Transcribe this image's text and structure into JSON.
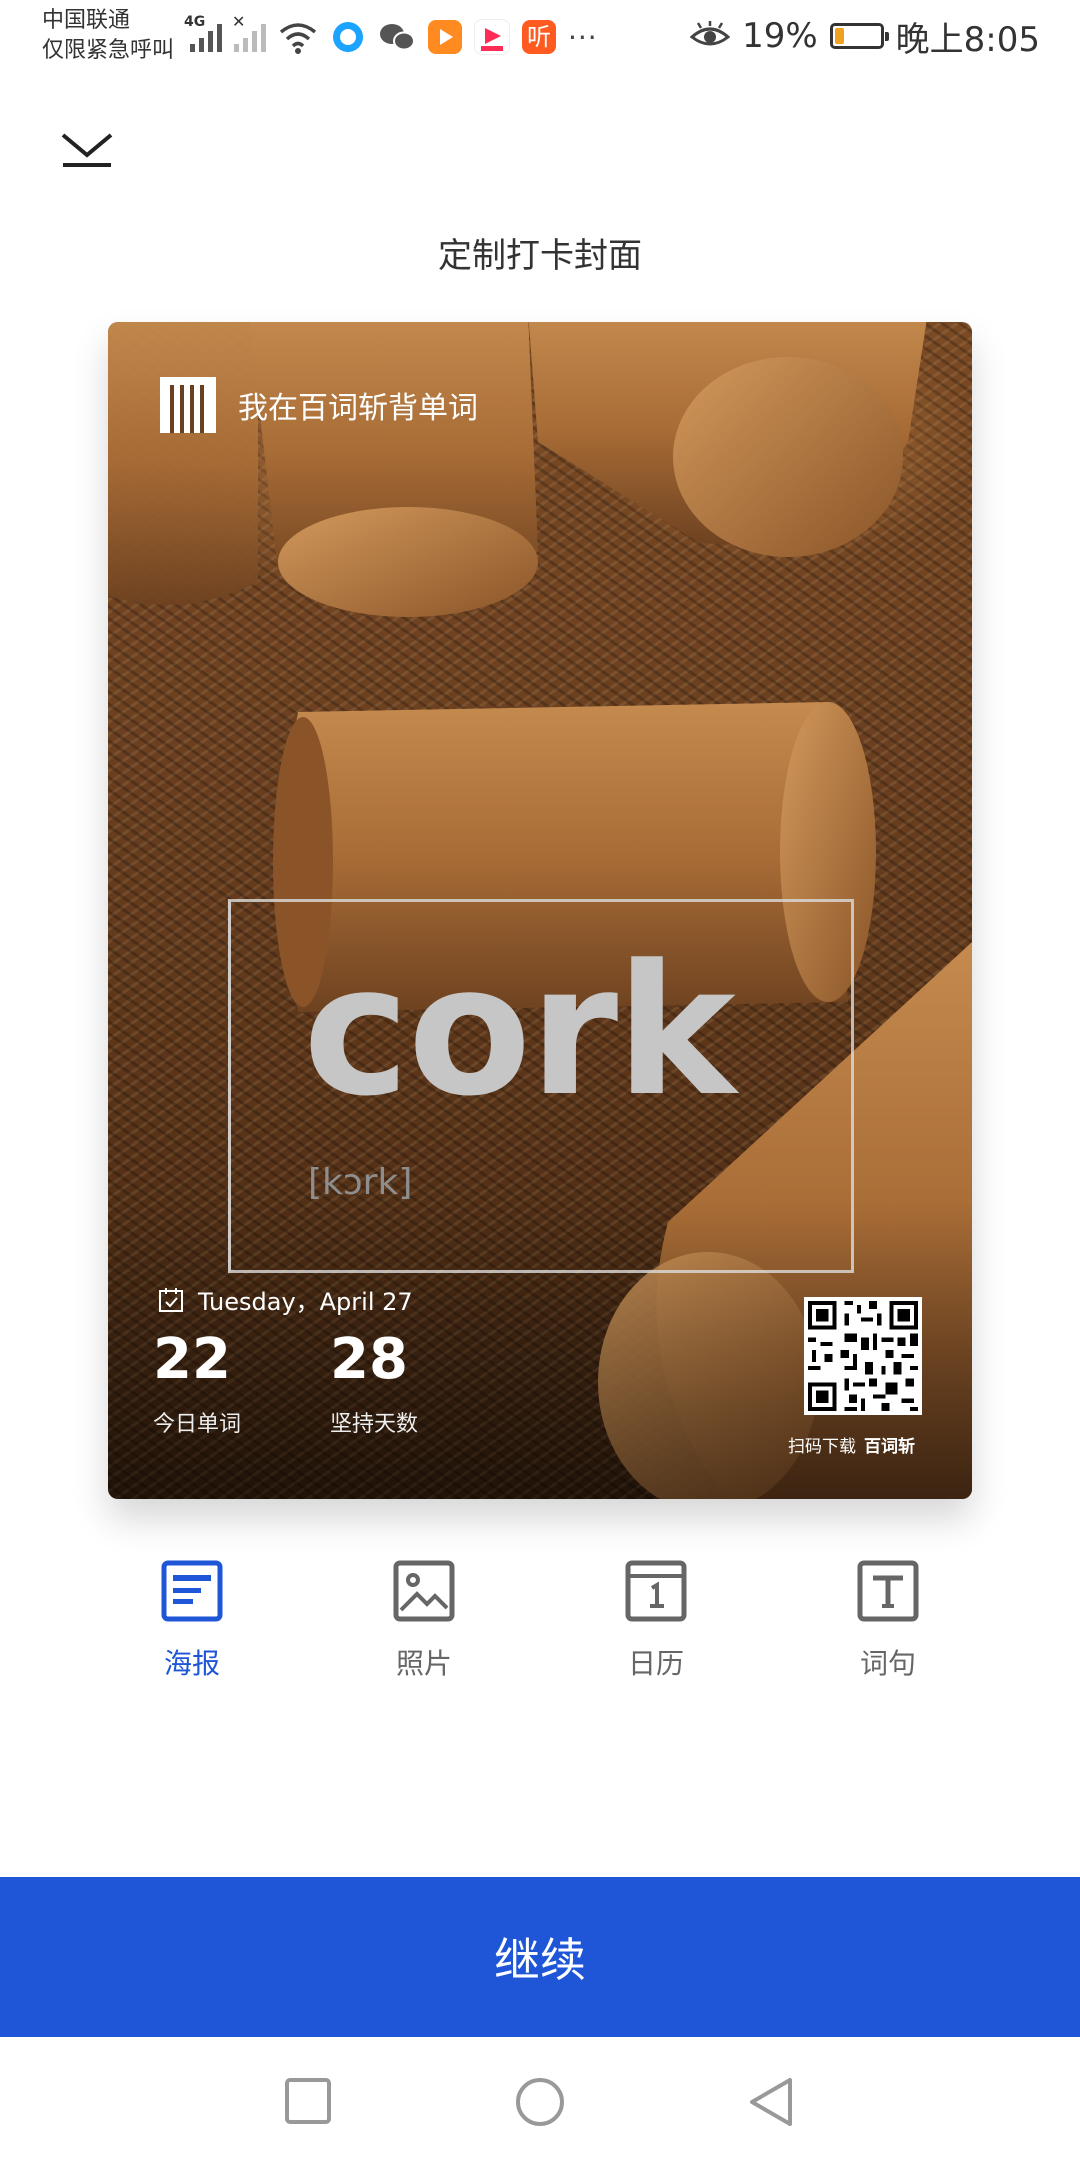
{
  "status_bar": {
    "carrier_line1": "中国联通",
    "carrier_line2": "仅限紧急呼叫",
    "network": "4G",
    "more": "···",
    "battery": "19%",
    "battery_level": 0.19,
    "time": "晚上8:05"
  },
  "header": {
    "close_icon": "chevron-down-icon",
    "title": "定制打卡封面"
  },
  "card": {
    "brand_text": "我在百词斩背单词",
    "word": "cork",
    "phonetic": "[kɔrk]",
    "date": "Tuesday，April 27",
    "stats": [
      {
        "value": "22",
        "label": "今日单词"
      },
      {
        "value": "28",
        "label": "坚持天数"
      }
    ],
    "qr_caption": "扫码下载",
    "qr_brand": "百词斩"
  },
  "tabs": [
    {
      "label": "海报",
      "icon": "poster-icon",
      "active": true
    },
    {
      "label": "照片",
      "icon": "photo-icon",
      "active": false
    },
    {
      "label": "日历",
      "icon": "calendar-icon",
      "active": false
    },
    {
      "label": "词句",
      "icon": "text-icon",
      "active": false
    }
  ],
  "continue_label": "继续",
  "colors": {
    "accent": "#1f56d8",
    "inactive": "#666666",
    "text": "#333333"
  }
}
